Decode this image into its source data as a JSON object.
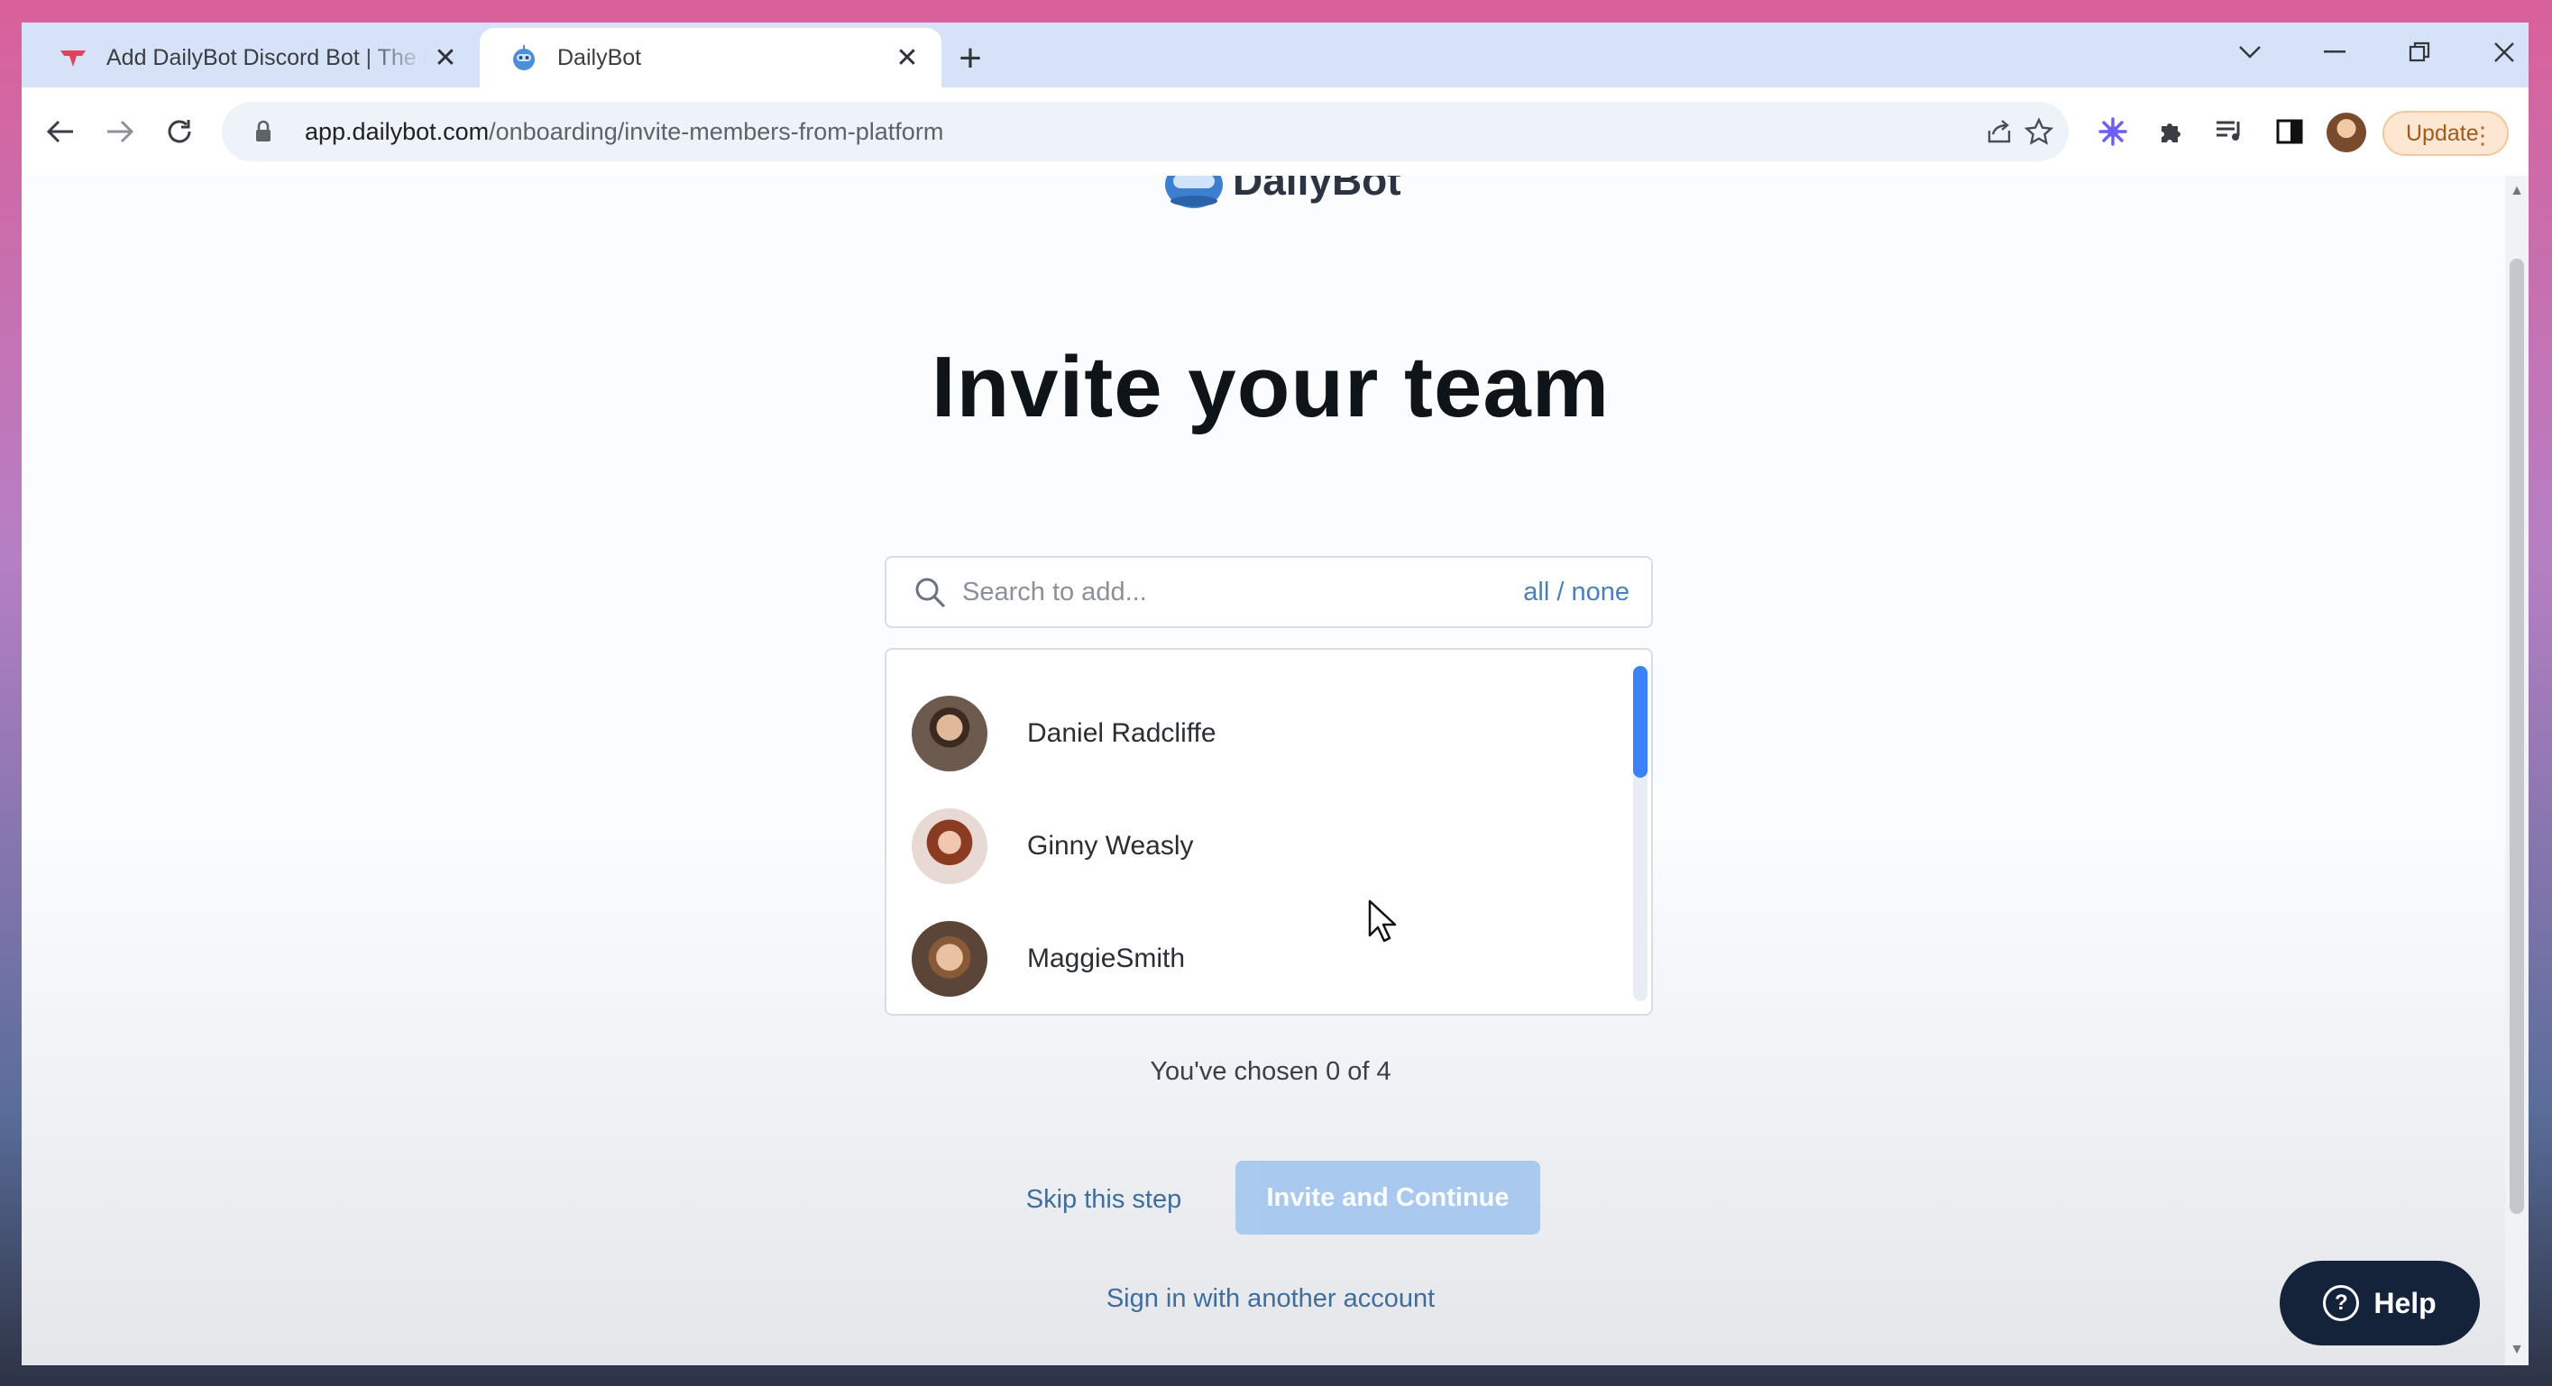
{
  "browser": {
    "tabs": [
      {
        "title": "Add DailyBot Discord Bot | The #",
        "close_symbol": "✕",
        "favicon": "dailybot-red-icon"
      },
      {
        "title": "DailyBot",
        "close_symbol": "✕",
        "favicon": "dailybot-blue-icon"
      }
    ],
    "new_tab_symbol": "+",
    "url_domain": "app.dailybot.com",
    "url_path": "/onboarding/invite-members-from-platform",
    "update_label": "Update"
  },
  "page": {
    "logo_text": "DailyBot",
    "headline": "Invite your team",
    "search": {
      "placeholder": "Search to add...",
      "select_label": "all / none"
    },
    "members": [
      {
        "name": "Daniel Radcliffe"
      },
      {
        "name": "Ginny Weasly"
      },
      {
        "name": "MaggieSmith"
      }
    ],
    "chosen_text": "You've chosen 0 of 4",
    "skip_label": "Skip this step",
    "invite_label": "Invite and Continue",
    "signin_label": "Sign in with another account",
    "help_label": "Help"
  },
  "colors": {
    "accent": "#3b82f6",
    "link": "#3f6d9e",
    "invite_disabled": "#a6c8ee",
    "help_bg": "#15233a"
  }
}
